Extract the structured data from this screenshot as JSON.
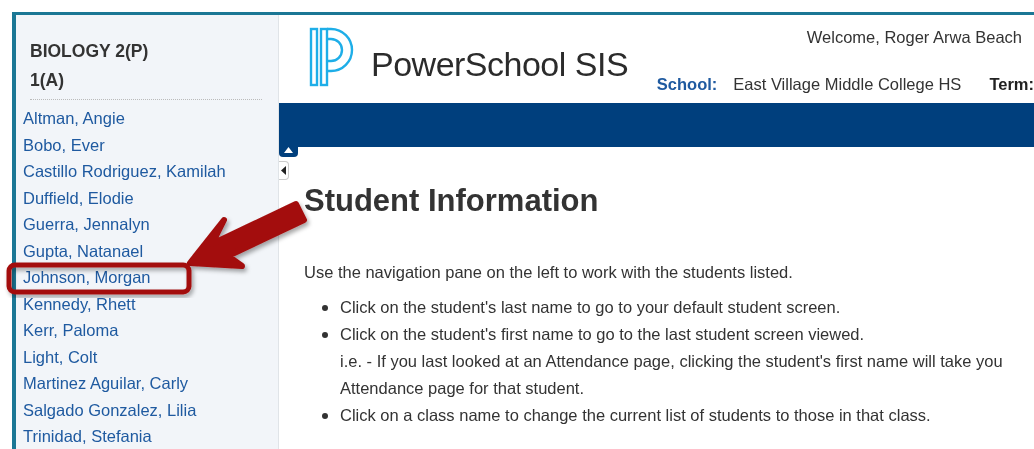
{
  "sidebar": {
    "title_lines": [
      "BIOLOGY 2(P)",
      "1(A)"
    ],
    "students": [
      "Altman, Angie",
      "Bobo, Ever",
      "Castillo Rodriguez, Kamilah",
      "Duffield, Elodie",
      "Guerra, Jennalyn",
      "Gupta, Natanael",
      "Johnson, Morgan",
      "Kennedy, Rhett",
      "Kerr, Paloma",
      "Light, Colt",
      "Martinez Aguilar, Carly",
      "Salgado Gonzalez, Lilia",
      "Trinidad, Stefania"
    ]
  },
  "header": {
    "app_name": "PowerSchool SIS",
    "welcome": "Welcome, Roger Arwa Beach",
    "school_label": "School:",
    "school": "East Village Middle College HS",
    "term_label": "Term:"
  },
  "content": {
    "title": "Student Information",
    "intro": "Use the navigation pane on the left to work with the students listed.",
    "bullets": [
      {
        "lines": [
          "Click on the student's last name to go to your default student screen."
        ]
      },
      {
        "lines": [
          "Click on the student's first name to go to the last student screen viewed.",
          "i.e. - If you last looked at an Attendance page, clicking the student's first name will take you",
          "Attendance page for that student."
        ]
      },
      {
        "lines": [
          "Click on a class name to change the current list of students to those in that class."
        ]
      }
    ]
  }
}
